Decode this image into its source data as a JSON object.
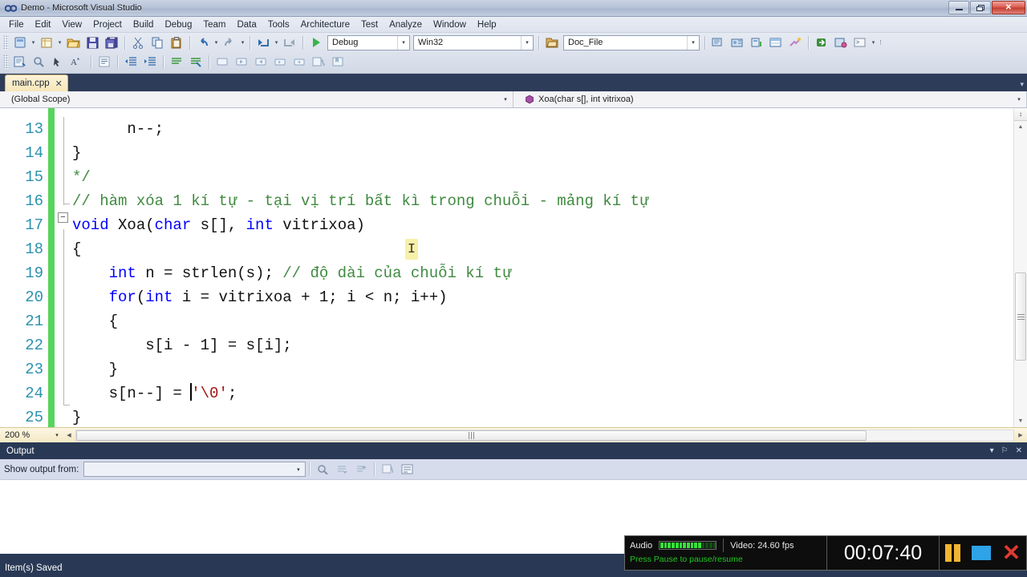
{
  "window": {
    "title": "Demo - Microsoft Visual Studio",
    "app_icon": "visual-studio-icon",
    "minimize_label": "–",
    "maximize_label": "❐",
    "close_label": "✕"
  },
  "menubar": {
    "items": [
      {
        "label": "File"
      },
      {
        "label": "Edit"
      },
      {
        "label": "View"
      },
      {
        "label": "Project"
      },
      {
        "label": "Build"
      },
      {
        "label": "Debug"
      },
      {
        "label": "Team"
      },
      {
        "label": "Data"
      },
      {
        "label": "Tools"
      },
      {
        "label": "Architecture"
      },
      {
        "label": "Test"
      },
      {
        "label": "Analyze"
      },
      {
        "label": "Window"
      },
      {
        "label": "Help"
      }
    ]
  },
  "toolbar": {
    "configuration": {
      "value": "Debug",
      "name": "solution-configuration-combo"
    },
    "platform": {
      "value": "Win32",
      "name": "solution-platform-combo"
    },
    "document": {
      "value": "Doc_File",
      "name": "document-outline-combo"
    },
    "row1_icons": [
      "new-project-icon",
      "new-item-icon",
      "open-file-icon",
      "save-icon",
      "save-all-icon",
      "cut-icon",
      "copy-icon",
      "paste-icon",
      "undo-icon",
      "redo-icon",
      "navigate-backward-icon",
      "navigate-forward-icon",
      "start-debugging-icon"
    ],
    "row2_icons": [
      "toggle-solution-explorer-icon",
      "properties-window-icon",
      "object-browser-icon",
      "toggle-word-wrap-icon",
      "display-tabs-icon",
      "decrease-indent-icon",
      "increase-indent-icon",
      "comment-icon",
      "uncomment-icon",
      "toggle-bookmark-icon",
      "previous-bookmark-icon",
      "next-bookmark-icon",
      "clear-bookmarks-icon",
      "bookmark-folder-icon",
      "breakpoints-icon",
      "toolbox-icon",
      "error-list-icon",
      "output-window-icon",
      "find-results-icon",
      "class-view-icon",
      "command-window-icon"
    ]
  },
  "document_tab": {
    "label": "main.cpp",
    "close_label": "✕"
  },
  "navbar": {
    "scope": "(Global Scope)",
    "member": "Xoa(char s[], int vitrixoa)",
    "member_icon": "method-icon"
  },
  "editor": {
    "first_visible_line": 13,
    "zoom": "200 %",
    "fold_marker": "−",
    "lines": [
      {
        "num": 13,
        "indent": 3,
        "tokens": [
          {
            "t": "n--;",
            "c": "plain"
          }
        ]
      },
      {
        "num": 14,
        "indent": 0,
        "tokens": [
          {
            "t": "}",
            "c": "plain"
          }
        ]
      },
      {
        "num": 15,
        "indent": 0,
        "tokens": [
          {
            "t": "*/",
            "c": "cmt"
          }
        ]
      },
      {
        "num": 16,
        "indent": 0,
        "tokens": [
          {
            "t": "// hàm xóa 1 kí tự - tại vị trí bất kì trong chuỗi - mảng kí tự",
            "c": "cmt"
          }
        ]
      },
      {
        "num": 17,
        "indent": 0,
        "tokens": [
          {
            "t": "void",
            "c": "kw"
          },
          {
            "t": " Xoa(",
            "c": "plain"
          },
          {
            "t": "char",
            "c": "kw"
          },
          {
            "t": " s[], ",
            "c": "plain"
          },
          {
            "t": "int",
            "c": "kw"
          },
          {
            "t": " vitrixoa)",
            "c": "plain"
          }
        ]
      },
      {
        "num": 18,
        "indent": 0,
        "tokens": [
          {
            "t": "{",
            "c": "plain"
          }
        ]
      },
      {
        "num": 19,
        "indent": 2,
        "tokens": [
          {
            "t": "int",
            "c": "kw"
          },
          {
            "t": " n = strlen(s); ",
            "c": "plain"
          },
          {
            "t": "// độ dài của chuỗi kí tự",
            "c": "cmt"
          }
        ]
      },
      {
        "num": 20,
        "indent": 2,
        "tokens": [
          {
            "t": "for",
            "c": "kw"
          },
          {
            "t": "(",
            "c": "plain"
          },
          {
            "t": "int",
            "c": "kw"
          },
          {
            "t": " i = vitrixoa + 1; i < n; i++)",
            "c": "plain"
          }
        ]
      },
      {
        "num": 21,
        "indent": 2,
        "tokens": [
          {
            "t": "{",
            "c": "plain"
          }
        ]
      },
      {
        "num": 22,
        "indent": 4,
        "tokens": [
          {
            "t": "s[i - 1] = s[i];",
            "c": "plain"
          }
        ]
      },
      {
        "num": 23,
        "indent": 2,
        "tokens": [
          {
            "t": "}",
            "c": "plain"
          }
        ]
      },
      {
        "num": 24,
        "indent": 2,
        "tokens": [
          {
            "t": "s[n--] = ",
            "c": "plain"
          },
          {
            "t": "CARET",
            "c": "caret"
          },
          {
            "t": "'\\0'",
            "c": "str"
          },
          {
            "t": ";",
            "c": "plain"
          }
        ]
      },
      {
        "num": 25,
        "indent": 0,
        "tokens": [
          {
            "t": "}",
            "c": "plain"
          }
        ]
      }
    ],
    "mouse_cursor": "text-ibeam-cursor"
  },
  "output": {
    "title": "Output",
    "show_output_from_label": "Show output from:",
    "show_output_from_value": "",
    "pane_buttons": {
      "dropdown": "▾",
      "pin": "⚐",
      "close": "✕"
    }
  },
  "statusbar": {
    "text": "Item(s) Saved"
  },
  "recorder": {
    "audio_label": "Audio",
    "video_label": "Video: 24.60 fps",
    "hint": "Press Pause to pause/resume",
    "time": "00:07:40",
    "pause_icon": "pause-icon",
    "stop_icon": "stop-icon",
    "close_icon": "close-icon",
    "meter_active_bars": 11,
    "meter_total_bars": 15
  },
  "colors": {
    "accent_blue": "#2b91af",
    "keyword_blue": "#0000ff",
    "comment_green": "#3f8a3f",
    "string_red": "#a31515",
    "change_bar_green": "#57d45c",
    "chrome_navy": "#293955",
    "tab_gold": "#f6e6b8"
  }
}
